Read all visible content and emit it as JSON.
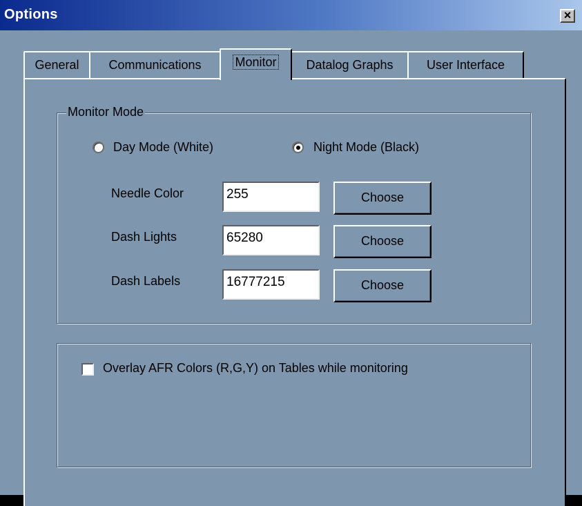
{
  "window": {
    "title": "Options",
    "close_label": "×"
  },
  "tabs": [
    "General",
    "Communications",
    "Monitor",
    "Datalog Graphs",
    "User Interface"
  ],
  "monitor_mode": {
    "group_label": "Monitor Mode",
    "day_mode_label": "Day Mode (White)",
    "night_mode_label": "Night Mode (Black)",
    "selected": "night",
    "needle_color": {
      "label": "Needle Color",
      "value": "255",
      "button": "Choose"
    },
    "dash_lights": {
      "label": "Dash Lights",
      "value": "65280",
      "button": "Choose"
    },
    "dash_labels": {
      "label": "Dash Labels",
      "value": "16777215",
      "button": "Choose"
    }
  },
  "overlay": {
    "label": "Overlay AFR Colors (R,G,Y) on Tables while monitoring",
    "checked": false
  }
}
